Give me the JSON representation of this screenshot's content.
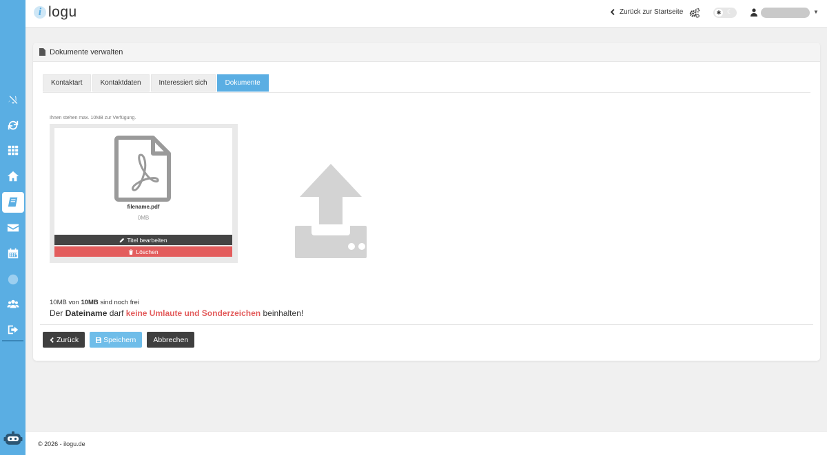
{
  "header": {
    "logo_i": "i",
    "logo_text": "logu",
    "back_link": "Zurück zur Startseite"
  },
  "sidebar": {
    "items": [
      {
        "icon": "bell-slash-icon"
      },
      {
        "icon": "refresh-icon"
      },
      {
        "icon": "grid-icon"
      },
      {
        "icon": "home-icon"
      },
      {
        "icon": "book-icon",
        "active": true
      },
      {
        "icon": "envelope-icon"
      },
      {
        "icon": "calendar-icon"
      },
      {
        "icon": "globe-icon",
        "muted": true
      },
      {
        "icon": "users-icon"
      },
      {
        "icon": "sign-out-icon"
      }
    ]
  },
  "card": {
    "title": "Dokumente verwalten",
    "tabs": [
      {
        "label": "Kontaktart"
      },
      {
        "label": "Kontaktdaten"
      },
      {
        "label": "Interessiert sich"
      },
      {
        "label": "Dokumente",
        "active": true
      }
    ],
    "avail_note": "Ihnen stehen max. 10MB zur Verfügung.",
    "document": {
      "filename": "filename.pdf",
      "size": "0MB",
      "edit_label": "Titel bearbeiten",
      "delete_label": "Löschen"
    },
    "space": {
      "used": "10MB",
      "of": "von",
      "total": "10MB",
      "rest": "sind noch frei"
    },
    "rule": {
      "part1": "Der",
      "part2": "Dateiname",
      "part3": "darf",
      "part4": "keine Umlaute und Sonderzeichen",
      "part5": "beinhalten!"
    },
    "buttons": {
      "back": "Zurück",
      "save": "Speichern",
      "cancel": "Abbrechen"
    }
  },
  "footer": {
    "text": "© 2026 - ilogu.de"
  },
  "colors": {
    "sidebar": "#5aaee3",
    "primary": "#5aaee3",
    "danger": "#e35d5d",
    "dark": "#3f3f3f"
  }
}
